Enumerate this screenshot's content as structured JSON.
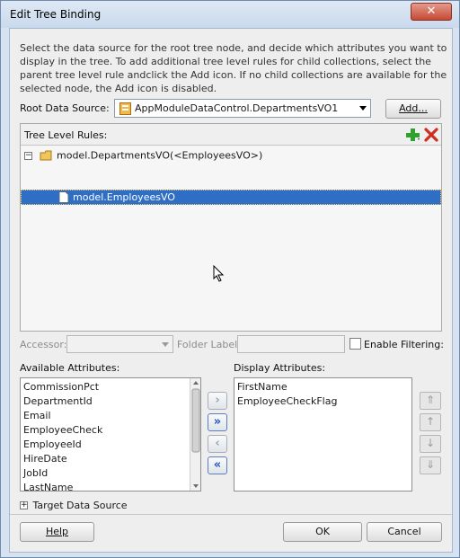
{
  "window": {
    "title": "Edit Tree Binding",
    "close_glyph": "✕"
  },
  "description": "Select the data source for the root tree node, and decide which attributes you want to display in the tree. To add additional tree level rules for child collections, select the parent tree level rule andclick the Add icon. If no child collections are available for the selected node, the Add icon is disabled.",
  "root_source": {
    "label": "Root Data Source:",
    "value": "AppModuleDataControl.DepartmentsVO1",
    "add_label": "Add..."
  },
  "tree_rules": {
    "label": "Tree Level Rules:",
    "nodes": [
      {
        "text": "model.DepartmentsVO(<EmployeesVO>)",
        "expander": "−"
      },
      {
        "text": "model.EmployeesVO"
      }
    ],
    "icons": {
      "add": "add-icon",
      "delete": "delete-icon"
    }
  },
  "accessor": {
    "label": "Accessor:",
    "folder_label": "Folder Label:",
    "enable_filtering": "Enable Filtering:"
  },
  "available": {
    "label": "Available Attributes:",
    "items": [
      "CommissionPct",
      "DepartmentId",
      "Email",
      "EmployeeCheck",
      "EmployeeId",
      "HireDate",
      "JobId",
      "LastName"
    ]
  },
  "display": {
    "label": "Display Attributes:",
    "items": [
      "FirstName",
      "EmployeeCheckFlag"
    ]
  },
  "shuttle": {
    "move": "›",
    "move_all": "»",
    "remove": "‹",
    "remove_all": "«"
  },
  "order": {
    "top": "⇑",
    "up": "↑",
    "down": "↓",
    "bottom": "⇓"
  },
  "target": {
    "expander": "+",
    "label": "Target Data Source"
  },
  "buttons": {
    "help": "Help",
    "ok": "OK",
    "cancel": "Cancel"
  },
  "colors": {
    "selection": "#2e6ec4",
    "accent": "#1c58c8",
    "close": "#c44a34"
  }
}
